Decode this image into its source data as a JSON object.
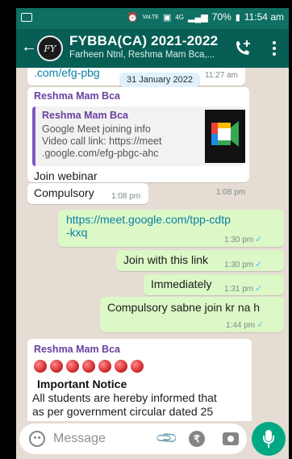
{
  "status_bar": {
    "battery": "70%",
    "time": "11:54 am",
    "network": "4G",
    "volte": "VoLTE"
  },
  "header": {
    "avatar_text": "FY",
    "title": "FYBBA(CA) 2021-2022",
    "subtitle": "Farheen Ntnl, Reshma Mam Bca,..."
  },
  "chat": {
    "date_chip": "31 January 2022",
    "partial_link": ".com/efg-pbg",
    "partial_time": "11:27 am",
    "messages": [
      {
        "sender": "Reshma Mam Bca",
        "quote": {
          "sender": "Reshma Mam Bca",
          "lines": [
            "Google Meet joining info",
            "Video call link: https://meet",
            ".google.com/efg-pbgc-ahc"
          ]
        },
        "text": "Join webinar",
        "time": "1:08 pm"
      },
      {
        "text": "Compulsory",
        "time": "1:08 pm"
      },
      {
        "link_line1": "https://meet.google.com/tpp-cdtp",
        "link_line2": "-kxq",
        "time": "1:30 pm"
      },
      {
        "text": "Join with this link",
        "time": "1:30 pm"
      },
      {
        "text": "Immediately",
        "time": "1:31 pm"
      },
      {
        "text": "Compulsory sabne join kr na h",
        "time": "1:44 pm"
      },
      {
        "sender": "Reshma Mam Bca",
        "heading": "Important Notice",
        "line1": "All students are hereby informed that",
        "line2": "as per government circular dated 25"
      }
    ]
  },
  "input": {
    "placeholder": "Message"
  },
  "colors": {
    "header": "#075e54",
    "outgoing": "#dcf8c6",
    "chat_bg": "#e5ddd4",
    "accent": "#00a884"
  }
}
